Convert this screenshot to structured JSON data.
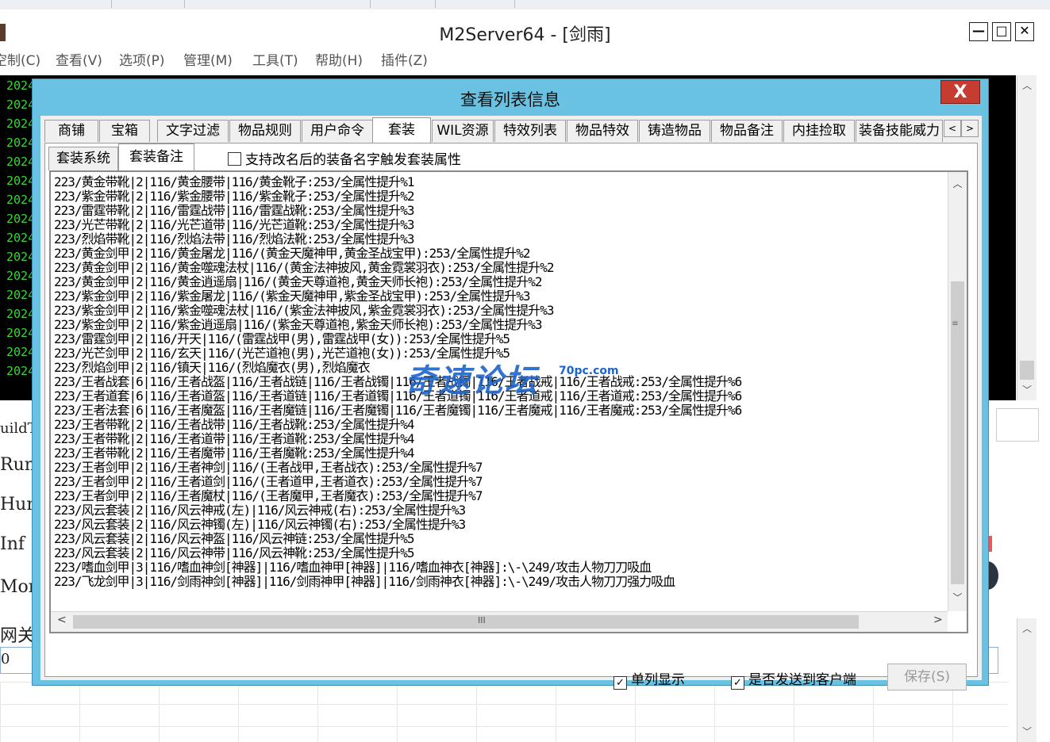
{
  "main_window": {
    "title": "M2Server64 - [剑雨]",
    "window_buttons": {
      "minimize": "—",
      "maximize": "□",
      "close": "✕"
    },
    "menu": [
      "空制(C)",
      "查看(V)",
      "选项(P)",
      "管理(M)",
      "工具(T)",
      "帮助(H)",
      "插件(Z)"
    ],
    "log_prefix": "2024",
    "edge_labels": [
      "uildT",
      "Run",
      "Hum",
      "Inf",
      "Mon",
      "网关",
      "0"
    ]
  },
  "dialog": {
    "title": "查看列表信息",
    "close_label": "X",
    "tabs": [
      "商铺",
      "宝箱",
      "文字过滤",
      "物品规则",
      "用户命令",
      "套装",
      "WIL资源",
      "特效列表",
      "物品特效",
      "铸造物品",
      "物品备注",
      "内挂捡取",
      "装备技能威力"
    ],
    "active_tab": "套装",
    "tab_scroll": {
      "left": "<",
      "right": ">"
    },
    "subtabs": [
      "套装系统",
      "套装备注"
    ],
    "active_subtab": "套装备注",
    "rename_trigger_checkbox": {
      "label": "支持改名后的装备名字触发套装属性",
      "checked": false
    },
    "list_rows": [
      "223/黄金带靴|2|116/黄金腰带|116/黄金靴子:253/全属性提升%1",
      "223/紫金带靴|2|116/紫金腰带|116/紫金靴子:253/全属性提升%2",
      "223/雷霆带靴|2|116/雷霆战带|116/雷霆战靴:253/全属性提升%3",
      "223/光芒带靴|2|116/光芒道带|116/光芒道靴:253/全属性提升%3",
      "223/烈焰带靴|2|116/烈焰法带|116/烈焰法靴:253/全属性提升%3",
      "223/黄金剑甲|2|116/黄金屠龙|116/(黄金天魔神甲,黄金圣战宝甲):253/全属性提升%2",
      "223/黄金剑甲|2|116/黄金噬魂法杖|116/(黄金法神披风,黄金霓裳羽衣):253/全属性提升%2",
      "223/黄金剑甲|2|116/黄金逍遥扇|116/(黄金天尊道袍,黄金天师长袍):253/全属性提升%2",
      "223/紫金剑甲|2|116/紫金屠龙|116/(紫金天魔神甲,紫金圣战宝甲):253/全属性提升%3",
      "223/紫金剑甲|2|116/紫金噬魂法杖|116/(紫金法神披风,紫金霓裳羽衣):253/全属性提升%3",
      "223/紫金剑甲|2|116/紫金逍遥扇|116/(紫金天尊道袍,紫金天师长袍):253/全属性提升%3",
      "223/雷霆剑甲|2|116/开天|116/(雷霆战甲(男),雷霆战甲(女)):253/全属性提升%5",
      "223/光芒剑甲|2|116/玄天|116/(光芒道袍(男),光芒道袍(女)):253/全属性提升%5",
      "223/烈焰剑甲|2|116/镇天|116/(烈焰魔衣(男),烈焰魔衣",
      "223/王者战套|6|116/王者战盔|116/王者战链|116/王者战镯|116/王者战镯|116/王者战戒|116/王者战戒:253/全属性提升%6",
      "223/王者道套|6|116/王者道盔|116/王者道链|116/王者道镯|116/王者道镯|116/王者道戒|116/王者道戒:253/全属性提升%6",
      "223/王者法套|6|116/王者魔盔|116/王者魔链|116/王者魔镯|116/王者魔镯|116/王者魔戒|116/王者魔戒:253/全属性提升%6",
      "223/王者带靴|2|116/王者战带|116/王者战靴:253/全属性提升%4",
      "223/王者带靴|2|116/王者道带|116/王者道靴:253/全属性提升%4",
      "223/王者带靴|2|116/王者魔带|116/王者魔靴:253/全属性提升%4",
      "223/王者剑甲|2|116/王者神剑|116/(王者战甲,王者战衣):253/全属性提升%7",
      "223/王者剑甲|2|116/王者道剑|116/(王者道甲,王者道衣):253/全属性提升%7",
      "223/王者剑甲|2|116/王者魔杖|116/(王者魔甲,王者魔衣):253/全属性提升%7",
      "223/风云套装|2|116/风云神戒(左)|116/风云神戒(右):253/全属性提升%3",
      "223/风云套装|2|116/风云神镯(左)|116/风云神镯(右):253/全属性提升%3",
      "223/风云套装|2|116/风云神盔|116/风云神链:253/全属性提升%5",
      "223/风云套装|2|116/风云神带|116/风云神靴:253/全属性提升%5",
      "223/嗜血剑甲|3|116/嗜血神剑[神器]|116/嗜血神甲[神器]|116/嗜血神衣[神器]:\\-\\249/攻击人物刀刀吸血",
      "223/飞龙剑甲|3|116/剑雨神剑[神器]|116/剑雨神甲[神器]|116/剑雨神衣[神器]:\\-\\249/攻击人物刀刀强力吸血"
    ],
    "vscroll": {
      "up": "︿",
      "down": "﹀",
      "grip": "≡"
    },
    "hscroll": {
      "left": "<",
      "right": ">",
      "grip": "III"
    },
    "single_column_checkbox": {
      "label": "单列显示",
      "checked": true
    },
    "send_to_client_checkbox": {
      "label": "是否发送到客户端",
      "checked": true
    },
    "save_button": "保存(S)",
    "watermark": "奇速论坛",
    "watermark_sub": "70pc.com"
  },
  "colors": {
    "dialog_frame": "#69c2e2",
    "close_button": "#c63c30",
    "log_text": "#38d838",
    "log_background": "#000000"
  }
}
